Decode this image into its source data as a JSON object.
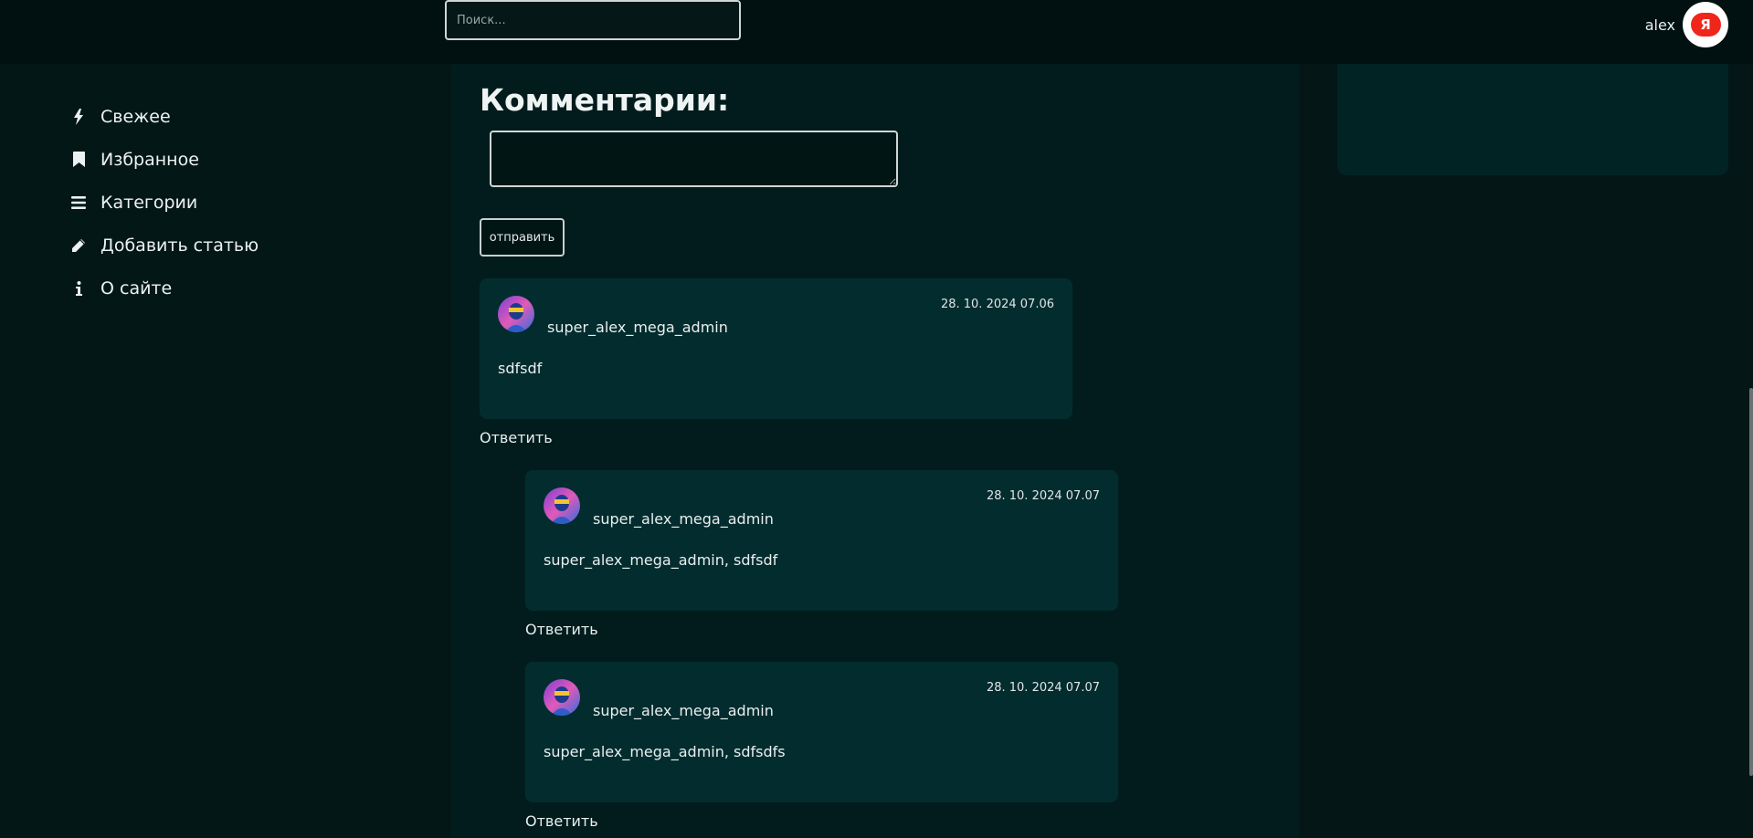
{
  "header": {
    "search_placeholder": "Поиск...",
    "username": "alex",
    "avatar_letter": "Я"
  },
  "sidebar": {
    "items": [
      {
        "label": "Свежее",
        "icon": "bolt-icon"
      },
      {
        "label": "Избранное",
        "icon": "bookmark-icon"
      },
      {
        "label": "Категории",
        "icon": "list-icon"
      },
      {
        "label": "Добавить статью",
        "icon": "pencil-icon"
      },
      {
        "label": "О сайте",
        "icon": "info-icon"
      }
    ]
  },
  "comments": {
    "title": "Комментарии:",
    "send_label": "отправить",
    "reply_label": "Ответить",
    "items": [
      {
        "author": "super_alex_mega_admin",
        "date": "28. 10. 2024 07.06",
        "text": "sdfsdf",
        "nested": false
      },
      {
        "author": "super_alex_mega_admin",
        "date": "28. 10. 2024 07.07",
        "text": "super_alex_mega_admin, sdfsdf",
        "nested": true
      },
      {
        "author": "super_alex_mega_admin",
        "date": "28. 10. 2024 07.07",
        "text": "super_alex_mega_admin, sdfsdfs",
        "nested": true
      }
    ]
  },
  "colors": {
    "page_bg": "#051616",
    "card_bg": "#032c2e",
    "avatar_badge": "#f0261b"
  }
}
